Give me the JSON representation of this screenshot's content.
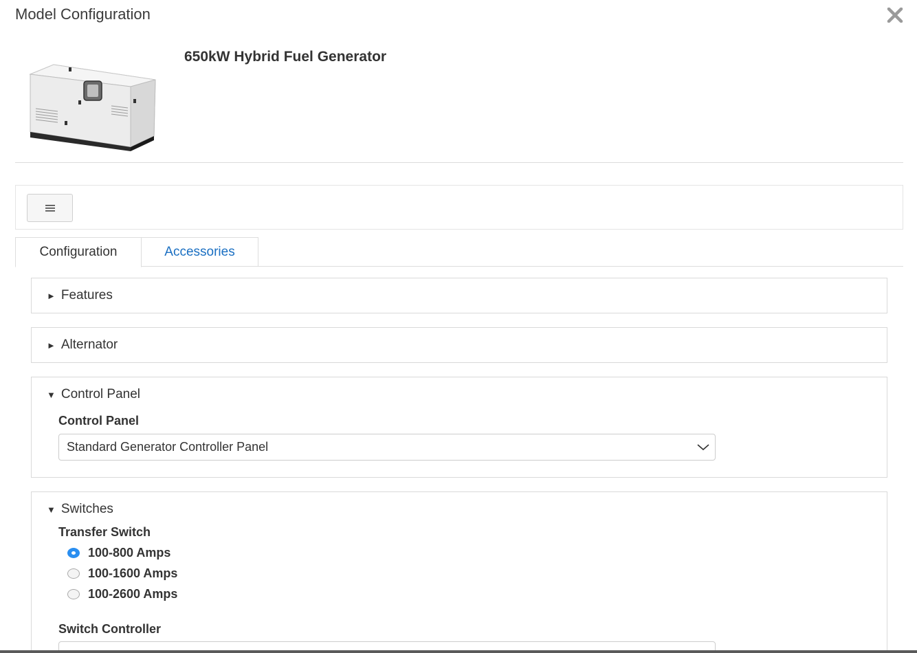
{
  "modal": {
    "title": "Model Configuration",
    "close_icon": "close-icon"
  },
  "product": {
    "title": "650kW Hybrid Fuel Generator",
    "image_icon": "generator-image"
  },
  "toolbar": {
    "menu_icon": "hamburger-menu-icon"
  },
  "tabs": [
    {
      "label": "Configuration",
      "active": true
    },
    {
      "label": "Accessories",
      "active": false
    }
  ],
  "sections": {
    "features": {
      "label": "Features",
      "expanded": false
    },
    "alternator": {
      "label": "Alternator",
      "expanded": false
    },
    "control_panel": {
      "label": "Control Panel",
      "expanded": true,
      "field_label": "Control Panel",
      "selected": "Standard Generator Controller Panel"
    },
    "switches": {
      "label": "Switches",
      "expanded": true,
      "transfer_switch_label": "Transfer Switch",
      "transfer_options": [
        {
          "label": "100-800 Amps",
          "checked": true
        },
        {
          "label": "100-1600 Amps",
          "checked": false
        },
        {
          "label": "100-2600 Amps",
          "checked": false
        }
      ],
      "switch_controller_label": "Switch Controller"
    }
  },
  "colors": {
    "link": "#1a6fc2",
    "radio_checked": "#2a8ef0",
    "border": "#d9d9d9"
  }
}
